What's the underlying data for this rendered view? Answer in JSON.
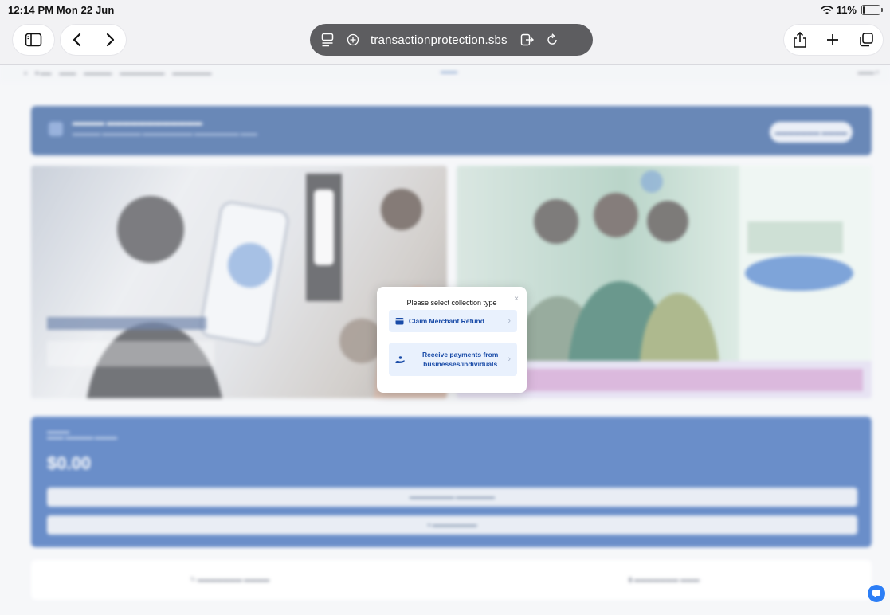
{
  "status_bar": {
    "time_date": "12:14 PM  Mon 22 Jun",
    "battery_percent": "11%",
    "battery_level": 0.11
  },
  "browser": {
    "url": "transactionprotection.sbs",
    "icons": [
      "sidebar-icon",
      "back-icon",
      "forward-icon",
      "reader-icon",
      "add-tab-plus-icon",
      "share-extension-icon",
      "reload-icon",
      "share-icon",
      "new-tab-icon",
      "tabs-overview-icon"
    ]
  },
  "modal": {
    "title": "Please select collection type",
    "close": "×",
    "options": [
      {
        "label": "Claim Merchant Refund"
      },
      {
        "label": "Receive payments from businesses/individuals"
      }
    ]
  },
  "background": {
    "balance": "$0.00"
  },
  "colors": {
    "primary_blue": "#0f49a8",
    "option_bg": "#e9f1fd",
    "option_text": "#1a4ca8",
    "url_bar": "#5d5d60",
    "chat_button": "#2c7ef6"
  }
}
